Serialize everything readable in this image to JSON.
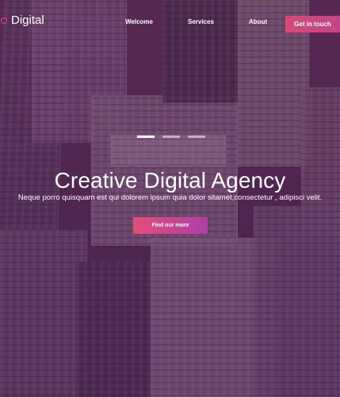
{
  "brand": {
    "name": "Digital",
    "icon": "ring-icon",
    "accent": "#e0479a"
  },
  "nav": {
    "items": [
      {
        "label": "Welcome"
      },
      {
        "label": "Services"
      },
      {
        "label": "About"
      }
    ],
    "cta_label": "Get in touch"
  },
  "carousel": {
    "slides": 3,
    "active_index": 0
  },
  "hero": {
    "title": "Creative Digital Agency",
    "subtitle": "Neque porro quisquam est qui dolorem ipsum quia dolor sitamet,consectetur , adipisci velit.",
    "cta_label": "Find our more"
  },
  "colors": {
    "button_pink": "#d44b79",
    "button_purple": "#ad3fa7",
    "overlay": "#6a2a5c"
  }
}
